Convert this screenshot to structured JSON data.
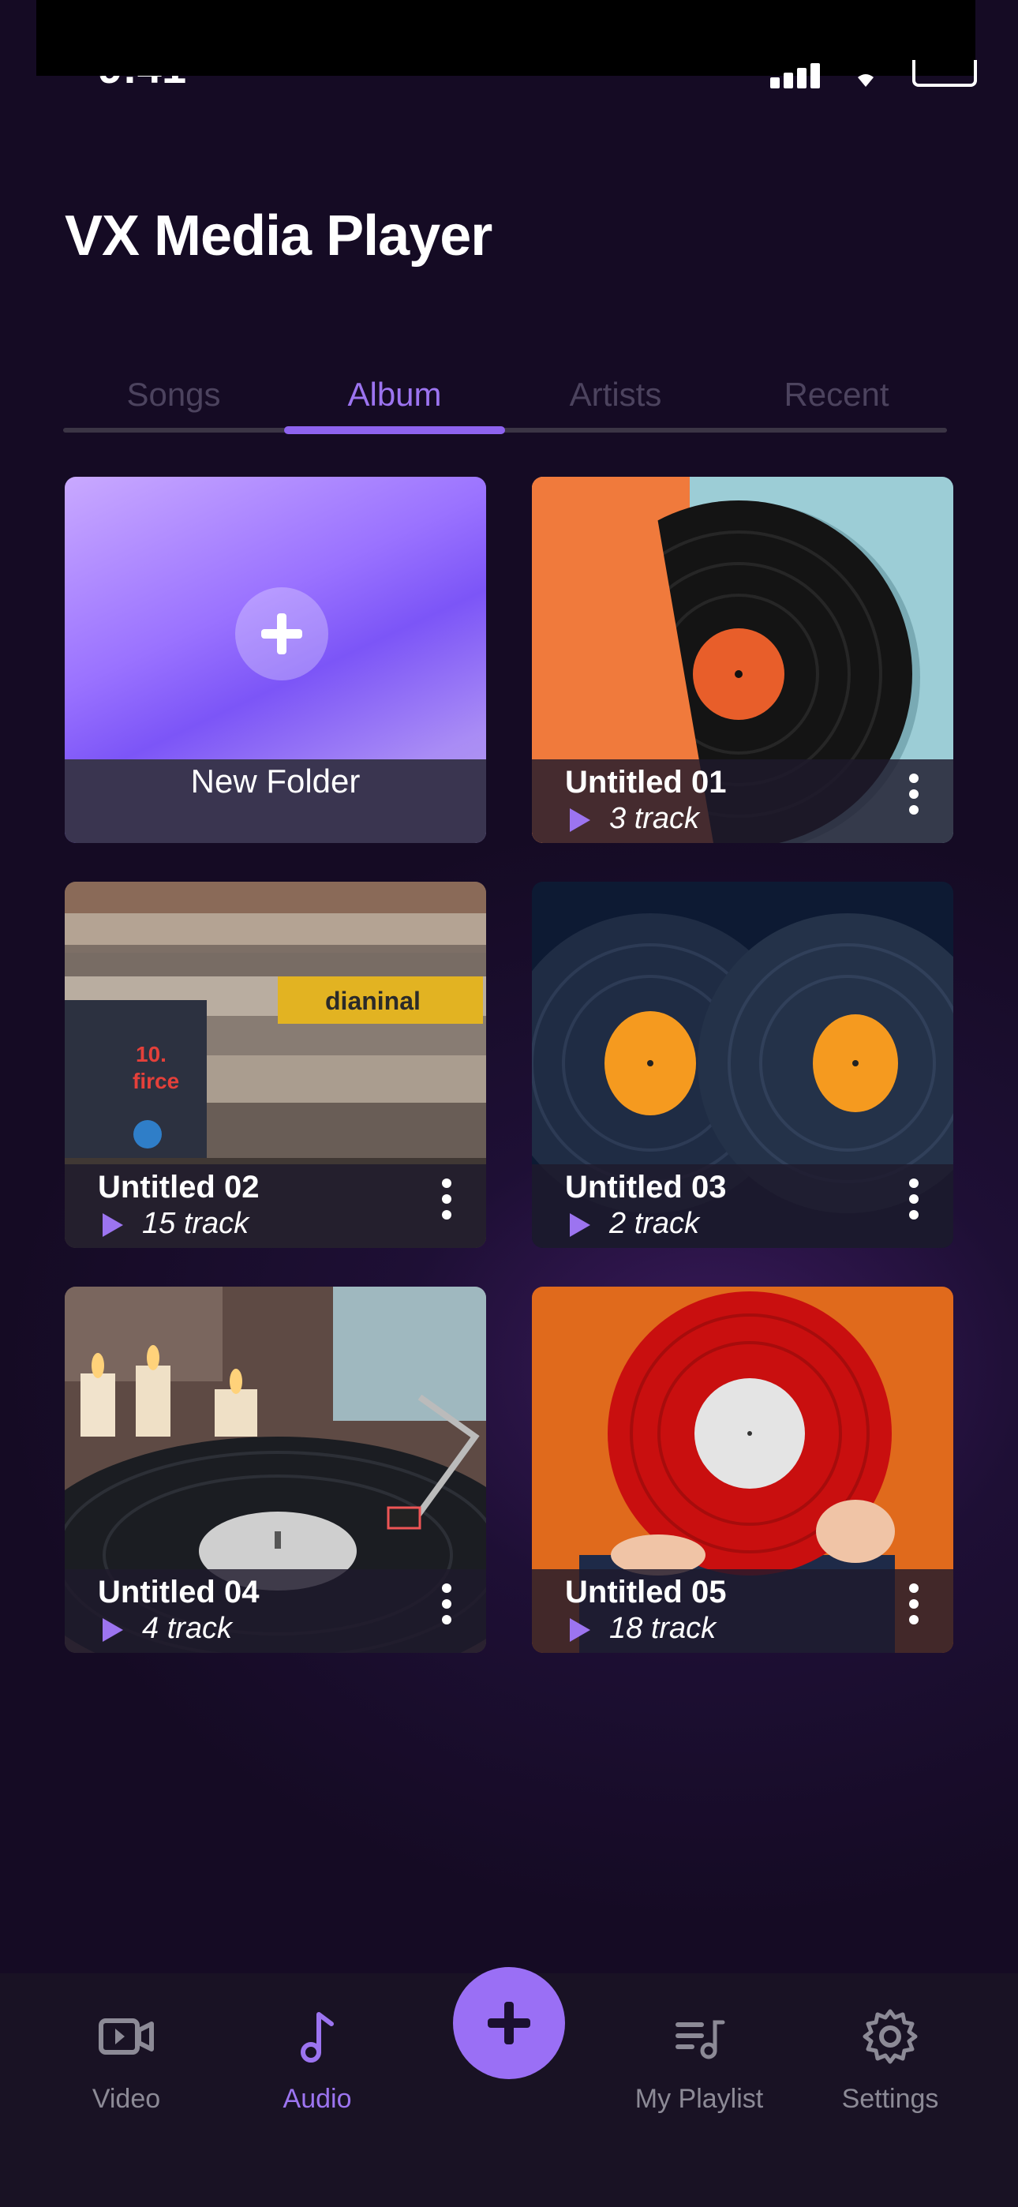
{
  "status": {
    "time": "9:41"
  },
  "app": {
    "title": "VX Media Player"
  },
  "tabs": [
    {
      "label": "Songs",
      "active": false
    },
    {
      "label": "Album",
      "active": true
    },
    {
      "label": "Artists",
      "active": false
    },
    {
      "label": "Recent",
      "active": false
    }
  ],
  "new_folder": {
    "label": "New Folder"
  },
  "albums": [
    {
      "name": "Untitled 01",
      "tracks": "3 track",
      "art": "vinyl-orange-sleeve"
    },
    {
      "name": "Untitled 02",
      "tracks": "15 track",
      "art": "record-crate"
    },
    {
      "name": "Untitled 03",
      "tracks": "2 track",
      "art": "two-dark-vinyls"
    },
    {
      "name": "Untitled 04",
      "tracks": "4 track",
      "art": "turntable-candles"
    },
    {
      "name": "Untitled 05",
      "tracks": "18 track",
      "art": "red-vinyl-held"
    }
  ],
  "nav": {
    "video": "Video",
    "audio": "Audio",
    "playlist": "My Playlist",
    "settings": "Settings",
    "active": "Audio"
  },
  "colors": {
    "accent": "#9c74f0",
    "background": "#1a0f2c",
    "inactive_tab": "#4c435e"
  }
}
